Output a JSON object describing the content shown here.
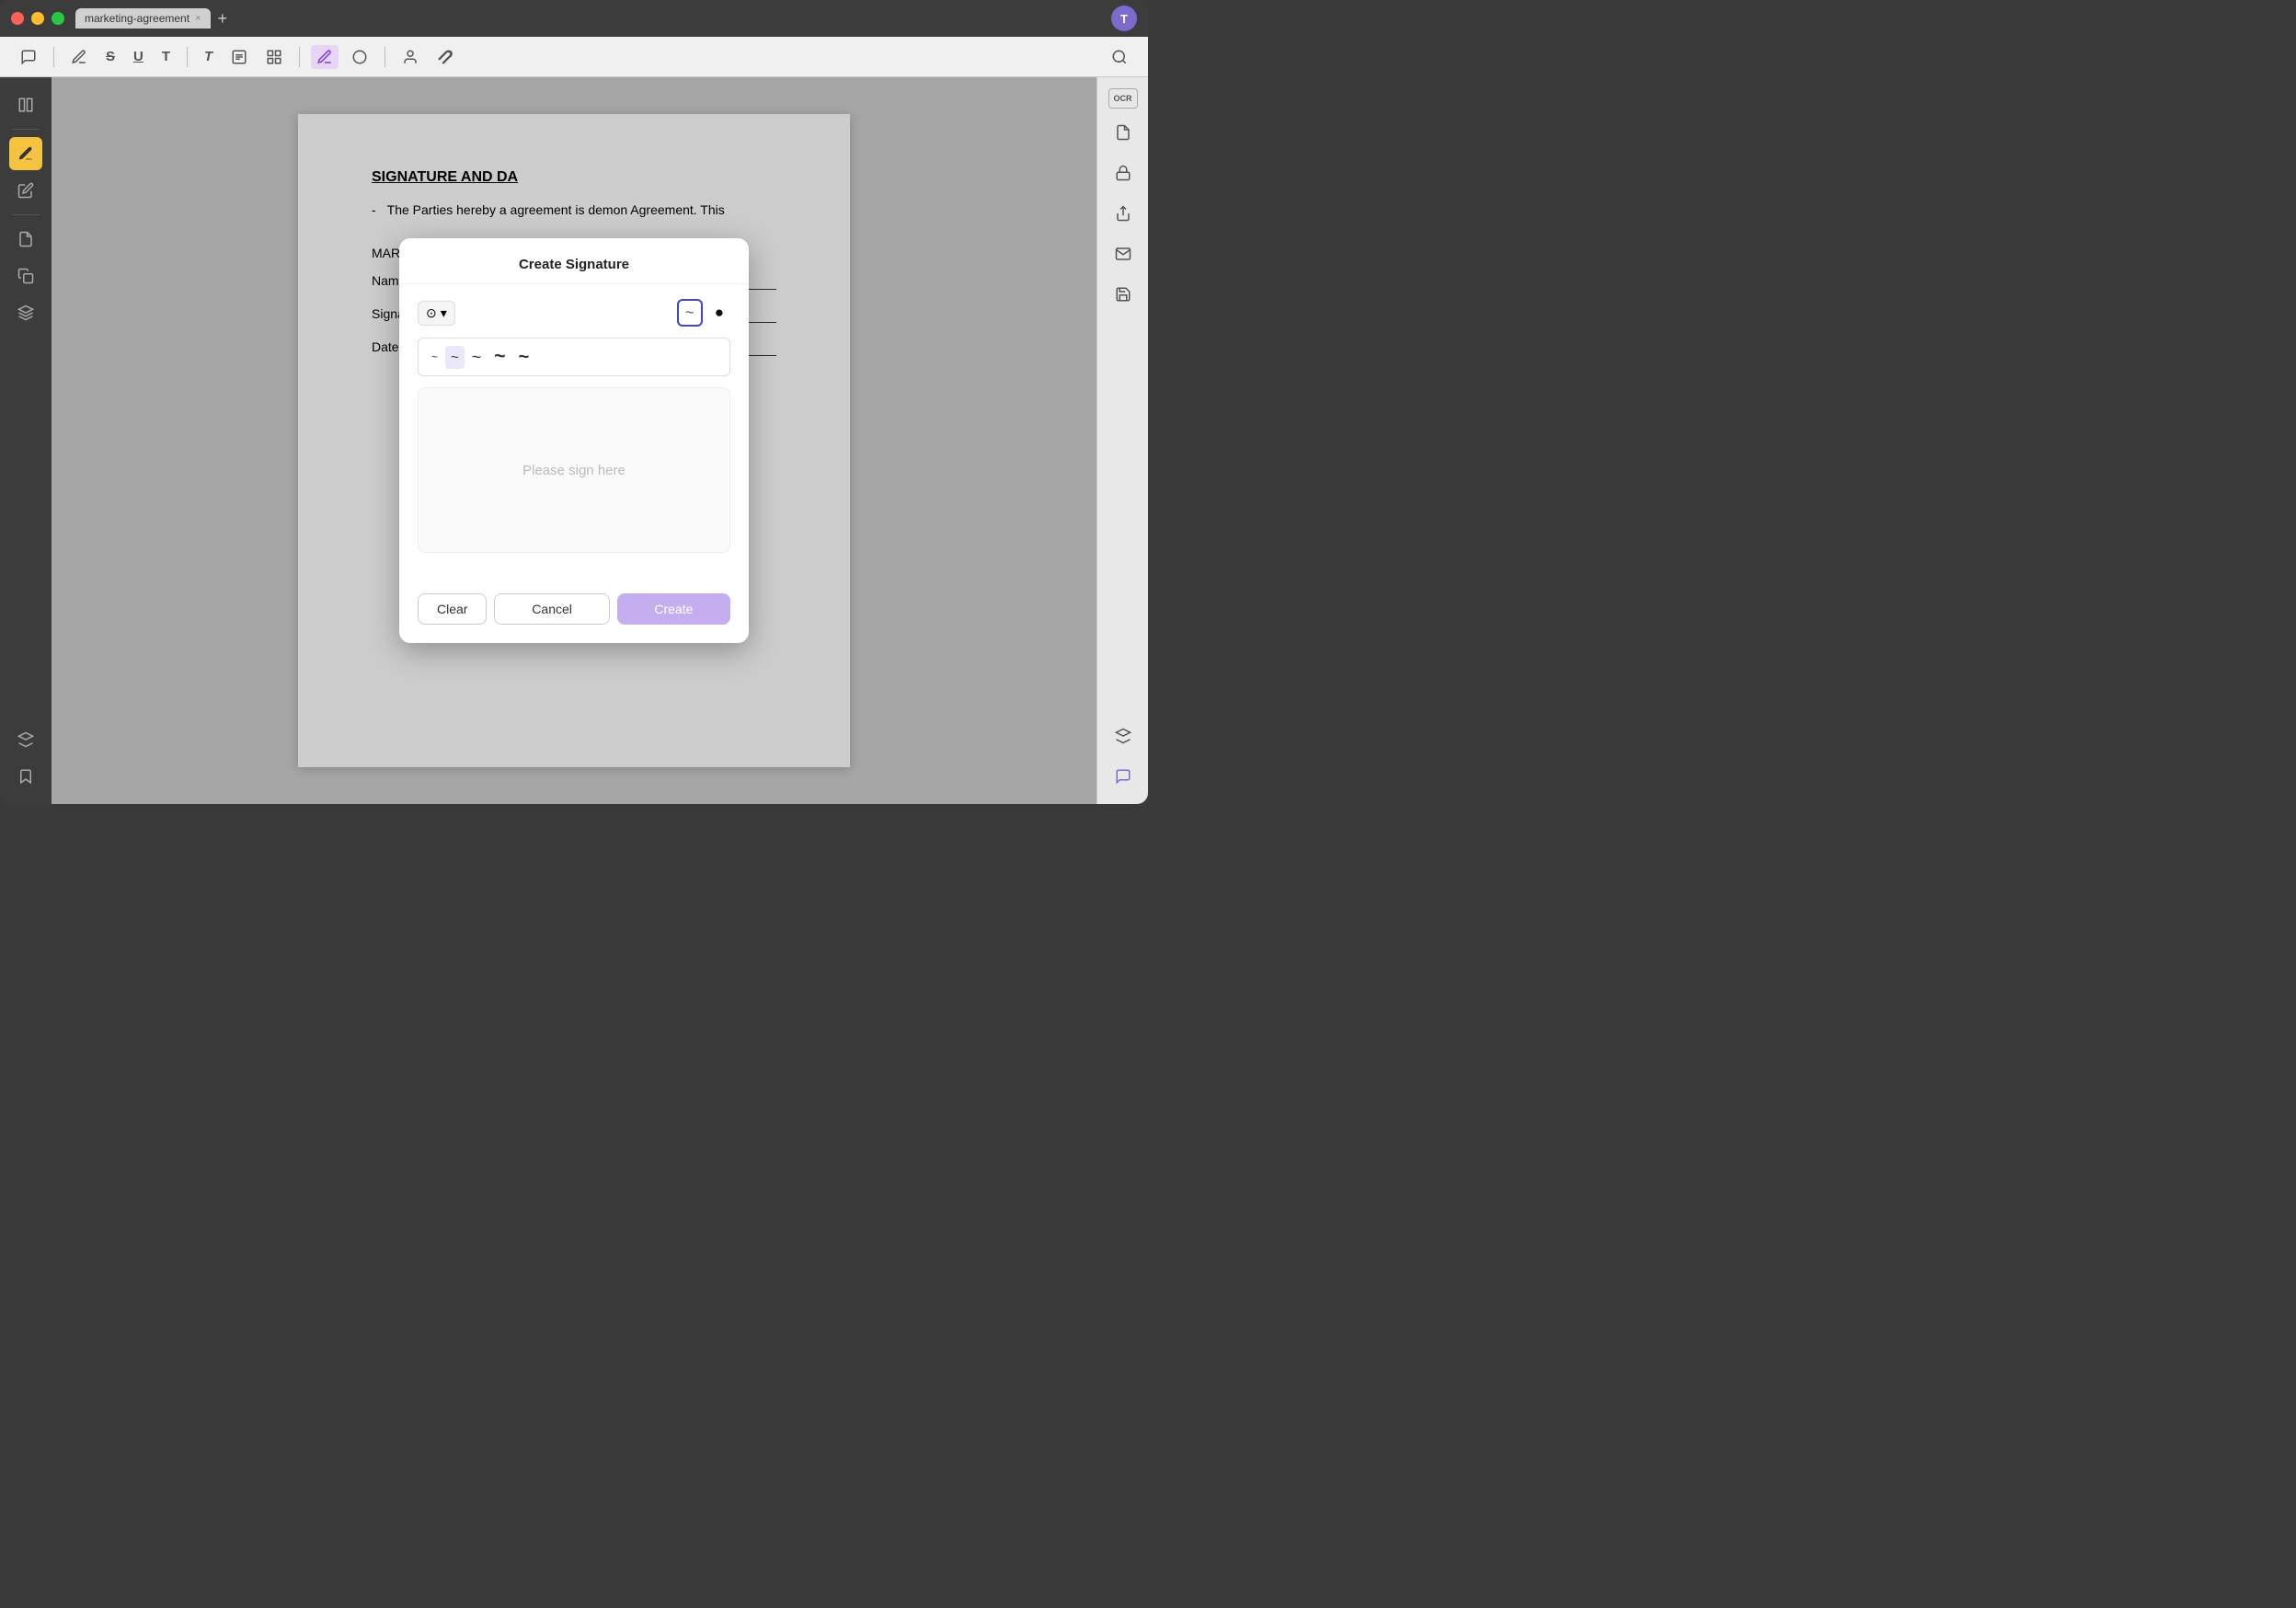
{
  "window": {
    "title": "marketing-agreement"
  },
  "titlebar": {
    "tab_label": "marketing-agreement",
    "user_initial": "T"
  },
  "toolbar": {
    "buttons": [
      {
        "name": "comment",
        "icon": "💬"
      },
      {
        "name": "highlight",
        "icon": "🖊"
      },
      {
        "name": "strikethrough",
        "icon": "S"
      },
      {
        "name": "underline",
        "icon": "U"
      },
      {
        "name": "text",
        "icon": "T"
      },
      {
        "name": "text-box",
        "icon": "T"
      },
      {
        "name": "text-block",
        "icon": "▤"
      },
      {
        "name": "grid",
        "icon": "⊞"
      },
      {
        "name": "draw",
        "icon": "✏"
      },
      {
        "name": "shape",
        "icon": "⬠"
      },
      {
        "name": "person",
        "icon": "👤"
      },
      {
        "name": "stamp",
        "icon": "📮"
      },
      {
        "name": "search",
        "icon": "🔍"
      }
    ]
  },
  "left_sidebar": {
    "buttons": [
      {
        "name": "panel-toggle",
        "icon": "▤",
        "active": false
      },
      {
        "name": "annotate",
        "icon": "✏",
        "active": true
      },
      {
        "name": "edit",
        "icon": "✏",
        "active": false
      },
      {
        "name": "layers",
        "icon": "⊞",
        "active": false
      },
      {
        "name": "pages",
        "icon": "📄",
        "active": false
      },
      {
        "name": "forms",
        "icon": "📋",
        "active": false
      },
      {
        "name": "bookmarks",
        "icon": "🔖",
        "active": false
      }
    ]
  },
  "document": {
    "section_title": "SIGNATURE AND DA",
    "party_line": "The Parties hereby a",
    "party_line2": "agreement is demon",
    "party_note": "Agreement. This",
    "marketer_label": "MARKETER",
    "name_label": "Name:",
    "signature_label": "Signature:",
    "date_label": "Date:"
  },
  "right_sidebar": {
    "buttons": [
      {
        "name": "ocr",
        "icon": "OCR"
      },
      {
        "name": "export-pdf",
        "icon": "↓"
      },
      {
        "name": "secure",
        "icon": "🔒"
      },
      {
        "name": "share",
        "icon": "↑"
      },
      {
        "name": "mail",
        "icon": "✉"
      },
      {
        "name": "save",
        "icon": "💾"
      },
      {
        "name": "layers2",
        "icon": "⊞"
      },
      {
        "name": "chat",
        "icon": "💬"
      }
    ]
  },
  "dialog": {
    "title": "Create Signature",
    "pen_icon": "⊙",
    "pen_dropdown": "▼",
    "stroke_options": [
      "~",
      "~",
      "~",
      "~",
      "~"
    ],
    "selected_stroke_index": 1,
    "color_options": [
      {
        "value": "~",
        "color": "selected"
      },
      {
        "value": "●",
        "color": "black"
      }
    ],
    "sign_placeholder": "Please sign here",
    "clear_label": "Clear",
    "cancel_label": "Cancel",
    "create_label": "Create"
  }
}
